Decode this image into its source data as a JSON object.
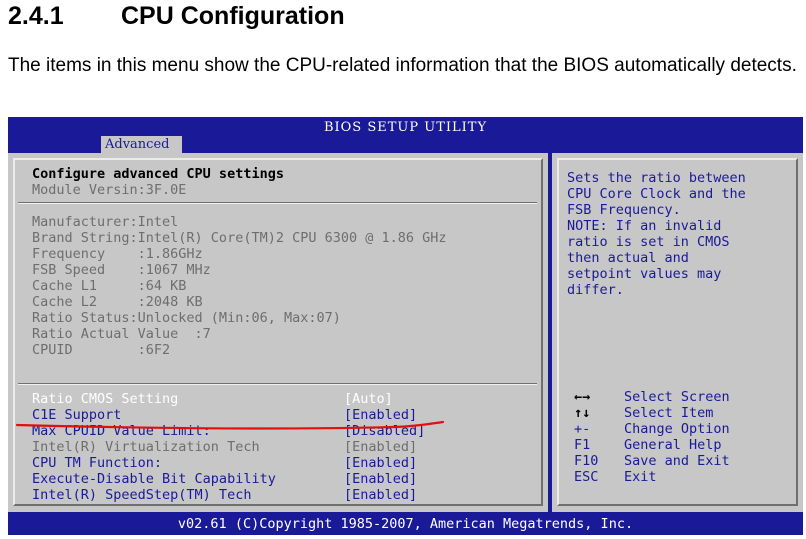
{
  "section": {
    "number": "2.4.1",
    "title": "CPU Configuration"
  },
  "intro": "The items in this menu show the CPU-related information that the BIOS automatically detects.",
  "bios": {
    "title": "BIOS SETUP UTILITY",
    "tab": "Advanced",
    "heading": "Configure advanced CPU settings",
    "module_version": "Module Versin:3F.0E",
    "info_lines": [
      "Manufacturer:Intel",
      "Brand String:Intel(R) Core(TM)2 CPU 6300 @ 1.86 GHz",
      "Frequency    :1.86GHz",
      "FSB Speed    :1067 MHz",
      "Cache L1     :64 KB",
      "Cache L2     :2048 KB",
      "Ratio Status:Unlocked (Min:06, Max:07)",
      "Ratio Actual Value  :7",
      "CPUID        :6F2"
    ],
    "settings": [
      {
        "label": "Ratio CMOS Setting",
        "value": "[Auto]"
      },
      {
        "label": "C1E Support",
        "value": "[Enabled]"
      },
      {
        "label": "Max CPUID Value Limit:",
        "value": "[Disabled]"
      },
      {
        "label": "Intel(R) Virtualization Tech",
        "value": "[Enabled]"
      },
      {
        "label": "CPU TM Function:",
        "value": "[Enabled]"
      },
      {
        "label": "Execute-Disable Bit Capability",
        "value": "[Enabled]"
      },
      {
        "label": "Intel(R) SpeedStep(TM) Tech",
        "value": "[Enabled]"
      }
    ],
    "help_lines": [
      "Sets the ratio between",
      "CPU Core Clock and the",
      "FSB Frequency.",
      "NOTE: If an invalid",
      "ratio is set in CMOS",
      "then actual and",
      "setpoint values may",
      "differ."
    ],
    "keys": [
      {
        "key": "←→",
        "desc": "Select Screen"
      },
      {
        "key": "↑↓",
        "desc": "Select Item"
      },
      {
        "key": "+-",
        "desc": "Change Option"
      },
      {
        "key": "F1",
        "desc": "General Help"
      },
      {
        "key": "F10",
        "desc": "Save and Exit"
      },
      {
        "key": "ESC",
        "desc": "Exit"
      }
    ],
    "footer": "v02.61 (C)Copyright 1985-2007, American Megatrends, Inc.",
    "colors": {
      "frame": "#1a1a98",
      "panel": "#c7c7c7",
      "annotation": "#e01010"
    }
  }
}
